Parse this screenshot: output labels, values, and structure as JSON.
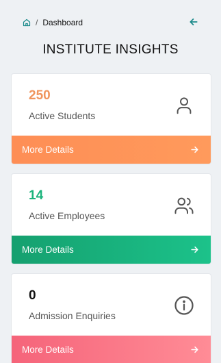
{
  "breadcrumb": {
    "home_icon": "home-icon",
    "separator": "/",
    "current": "Dashboard"
  },
  "back_icon": "arrow-left-icon",
  "page_title": "INSTITUTE INSIGHTS",
  "cards": [
    {
      "value": "250",
      "label": "Active Students",
      "icon": "user-icon",
      "footer_label": "More Details",
      "value_color": "#f0955d",
      "footer_gradient": [
        "#fe8e55",
        "#ff9a5c"
      ]
    },
    {
      "value": "14",
      "label": "Active Employees",
      "icon": "users-icon",
      "footer_label": "More Details",
      "value_color": "#1bb37c",
      "footer_gradient": [
        "#15a06f",
        "#1cc28a"
      ]
    },
    {
      "value": "0",
      "label": "Admission Enquiries",
      "icon": "info-circle-icon",
      "footer_label": "More Details",
      "value_color": "#111111",
      "footer_gradient": [
        "#f5647a",
        "#ff8c96"
      ]
    }
  ],
  "colors": {
    "accent": "#1a8a8a",
    "background": "#eef1f4"
  }
}
